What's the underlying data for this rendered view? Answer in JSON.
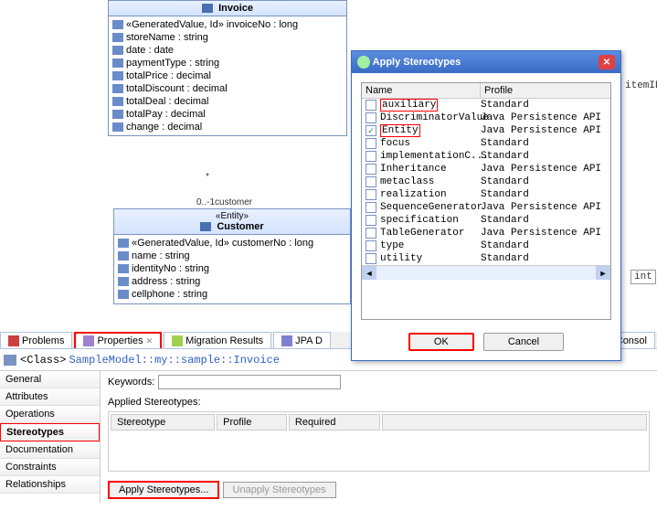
{
  "uml": {
    "invoice": {
      "title": "Invoice",
      "rows": [
        "«GeneratedValue, Id» invoiceNo : long",
        "storeName : string",
        "date : date",
        "paymentType : string",
        "totalPrice : decimal",
        "totalDiscount : decimal",
        "totalDeal : decimal",
        "totalPay : decimal",
        "change : decimal"
      ]
    },
    "rel_star": "*",
    "rel_label": "0..-1customer",
    "customer": {
      "stereo": "«Entity»",
      "title": "Customer",
      "rows": [
        "«GeneratedValue, Id» customerNo : long",
        "name : string",
        "identityNo : string",
        "address : string",
        "cellphone : string"
      ]
    }
  },
  "tabs": {
    "problems": "Problems",
    "properties": "Properties",
    "migration": "Migration Results",
    "jpa": "JPA D",
    "console": "Consol"
  },
  "props": {
    "class_label": "<Class>",
    "path": "SampleModel::my::sample::Invoice",
    "nav": {
      "general": "General",
      "attributes": "Attributes",
      "operations": "Operations",
      "stereotypes": "Stereotypes",
      "documentation": "Documentation",
      "constraints": "Constraints",
      "relationships": "Relationships"
    },
    "keywords_label": "Keywords:",
    "applied_label": "Applied Stereotypes:",
    "cols": {
      "stereotype": "Stereotype",
      "profile": "Profile",
      "required": "Required"
    },
    "apply_btn": "Apply Stereotypes...",
    "unapply_btn": "Unapply Stereotypes"
  },
  "dialog": {
    "title": "Apply Stereotypes",
    "col_name": "Name",
    "col_profile": "Profile",
    "rows": [
      {
        "name": "auxiliary",
        "profile": "Standard",
        "checked": false,
        "highlight": true
      },
      {
        "name": "DiscriminatorValue",
        "profile": "Java Persistence API",
        "checked": false
      },
      {
        "name": "Entity",
        "profile": "Java Persistence API",
        "checked": true,
        "highlight": true
      },
      {
        "name": "focus",
        "profile": "Standard",
        "checked": false
      },
      {
        "name": "implementationC...",
        "profile": "Standard",
        "checked": false
      },
      {
        "name": "Inheritance",
        "profile": "Java Persistence API",
        "checked": false
      },
      {
        "name": "metaclass",
        "profile": "Standard",
        "checked": false
      },
      {
        "name": "realization",
        "profile": "Standard",
        "checked": false
      },
      {
        "name": "SequenceGenerator",
        "profile": "Java Persistence API",
        "checked": false
      },
      {
        "name": "specification",
        "profile": "Standard",
        "checked": false
      },
      {
        "name": "TableGenerator",
        "profile": "Java Persistence API",
        "checked": false
      },
      {
        "name": "type",
        "profile": "Standard",
        "checked": false
      },
      {
        "name": "utility",
        "profile": "Standard",
        "checked": false
      }
    ],
    "ok": "OK",
    "cancel": "Cancel"
  },
  "bg": {
    "f1": "itemID",
    "f2": "int"
  }
}
